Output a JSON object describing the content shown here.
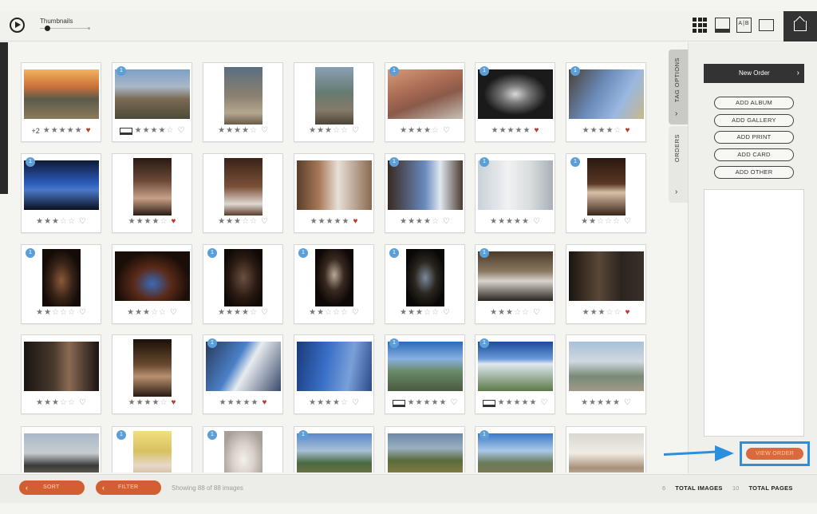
{
  "toolbar": {
    "view_label": "Thumbnails",
    "zoom_level": 0.15,
    "view_modes": [
      {
        "name": "grid",
        "active": true
      },
      {
        "name": "list"
      },
      {
        "name": "compare",
        "label": "A|B"
      },
      {
        "name": "single"
      }
    ]
  },
  "side_tabs": [
    {
      "label": "TAG OPTIONS",
      "chevron": "›"
    },
    {
      "label": "ORDERS",
      "chevron": "›"
    }
  ],
  "panel": {
    "new_order_label": "New Order",
    "new_order_chevron": "›",
    "add_buttons": [
      "ADD ALBUM",
      "ADD GALLERY",
      "ADD PRINT",
      "ADD CARD",
      "ADD OTHER"
    ],
    "view_order_label": "VIEW ORDER"
  },
  "thumbnails": [
    {
      "scene": "sunset-cliffs",
      "badge": "",
      "extra": "+2",
      "album": false,
      "stars": 5,
      "fav": true
    },
    {
      "scene": "rocks-valley",
      "badge": "1",
      "extra": "",
      "album": true,
      "stars": 4,
      "fav": false
    },
    {
      "scene": "couple-rock-portrait",
      "badge": "",
      "extra": "",
      "album": false,
      "stars": 4,
      "fav": false
    },
    {
      "scene": "mountain-portrait",
      "badge": "",
      "extra": "",
      "album": false,
      "stars": 3,
      "fav": false
    },
    {
      "scene": "couple-canyon",
      "badge": "1",
      "extra": "",
      "album": false,
      "stars": 4,
      "fav": false
    },
    {
      "scene": "dark-window",
      "badge": "1",
      "extra": "",
      "album": false,
      "stars": 5,
      "fav": true
    },
    {
      "scene": "balcony-sky",
      "badge": "1",
      "extra": "",
      "album": false,
      "stars": 4,
      "fav": true
    },
    {
      "scene": "blue-window",
      "badge": "1",
      "extra": "",
      "album": false,
      "stars": 3,
      "fav": false
    },
    {
      "scene": "bride-closeup",
      "badge": "",
      "extra": "",
      "album": false,
      "stars": 4,
      "fav": true
    },
    {
      "scene": "bride-seated",
      "badge": "",
      "extra": "",
      "album": false,
      "stars": 3,
      "fav": false
    },
    {
      "scene": "window-light-room",
      "badge": "",
      "extra": "",
      "album": false,
      "stars": 5,
      "fav": true
    },
    {
      "scene": "doorway-bright",
      "badge": "1",
      "extra": "",
      "album": false,
      "stars": 4,
      "fav": false
    },
    {
      "scene": "bright-window",
      "badge": "1",
      "extra": "",
      "album": false,
      "stars": 5,
      "fav": false
    },
    {
      "scene": "shoes-detail",
      "badge": "1",
      "extra": "",
      "album": false,
      "stars": 2,
      "fav": false
    },
    {
      "scene": "perfume-bottle",
      "badge": "1",
      "extra": "",
      "album": false,
      "stars": 2,
      "fav": false
    },
    {
      "scene": "blue-shoes",
      "badge": "",
      "extra": "",
      "album": false,
      "stars": 3,
      "fav": false
    },
    {
      "scene": "earrings",
      "badge": "1",
      "extra": "",
      "album": false,
      "stars": 4,
      "fav": false
    },
    {
      "scene": "necklace",
      "badge": "1",
      "extra": "",
      "album": false,
      "stars": 2,
      "fav": false
    },
    {
      "scene": "rings",
      "badge": "1",
      "extra": "",
      "album": false,
      "stars": 3,
      "fav": false
    },
    {
      "scene": "groomsmen-room",
      "badge": "1",
      "extra": "",
      "album": false,
      "stars": 3,
      "fav": false
    },
    {
      "scene": "groom-suit",
      "badge": "",
      "extra": "",
      "album": false,
      "stars": 3,
      "fav": true
    },
    {
      "scene": "couple-dark",
      "badge": "",
      "extra": "",
      "album": false,
      "stars": 3,
      "fav": false
    },
    {
      "scene": "couple-warm",
      "badge": "",
      "extra": "",
      "album": false,
      "stars": 4,
      "fav": true
    },
    {
      "scene": "balcony-group",
      "badge": "1",
      "extra": "",
      "album": false,
      "stars": 5,
      "fav": true
    },
    {
      "scene": "blue-terrace",
      "badge": "",
      "extra": "",
      "album": false,
      "stars": 4,
      "fav": false
    },
    {
      "scene": "valley-couple",
      "badge": "1",
      "extra": "",
      "album": true,
      "stars": 5,
      "fav": false
    },
    {
      "scene": "sun-group",
      "badge": "1",
      "extra": "",
      "album": true,
      "stars": 5,
      "fav": false
    },
    {
      "scene": "mountain-kiss",
      "badge": "",
      "extra": "",
      "album": false,
      "stars": 5,
      "fav": false
    },
    {
      "scene": "suits-group",
      "badge": "",
      "extra": "",
      "album": false,
      "stars": 0,
      "fav": false
    },
    {
      "scene": "bride-garden",
      "badge": "1",
      "extra": "",
      "album": false,
      "stars": 0,
      "fav": false
    },
    {
      "scene": "bouquet",
      "badge": "1",
      "extra": "",
      "album": false,
      "stars": 0,
      "fav": false
    },
    {
      "scene": "aerial-field",
      "badge": "1",
      "extra": "",
      "album": false,
      "stars": 0,
      "fav": false
    },
    {
      "scene": "aerial-fields",
      "badge": "",
      "extra": "",
      "album": false,
      "stars": 0,
      "fav": false
    },
    {
      "scene": "aerial-sky",
      "badge": "1",
      "extra": "",
      "album": false,
      "stars": 0,
      "fav": false
    },
    {
      "scene": "outdoor-ceremony",
      "badge": "",
      "extra": "",
      "album": false,
      "stars": 0,
      "fav": false
    }
  ],
  "footer": {
    "sort_label": "SORT",
    "filter_label": "FILTER",
    "back_glyph": "‹",
    "showing_text": "Showing 88 of 88 images",
    "total_images_count": "6",
    "total_images_label": "TOTAL IMAGES",
    "total_pages_count": "10",
    "total_pages_label": "TOTAL PAGES"
  },
  "colors": {
    "accent": "#d25f32",
    "highlight": "#2a8fdc",
    "badge": "#5b9fd6",
    "fav": "#c0392b"
  }
}
